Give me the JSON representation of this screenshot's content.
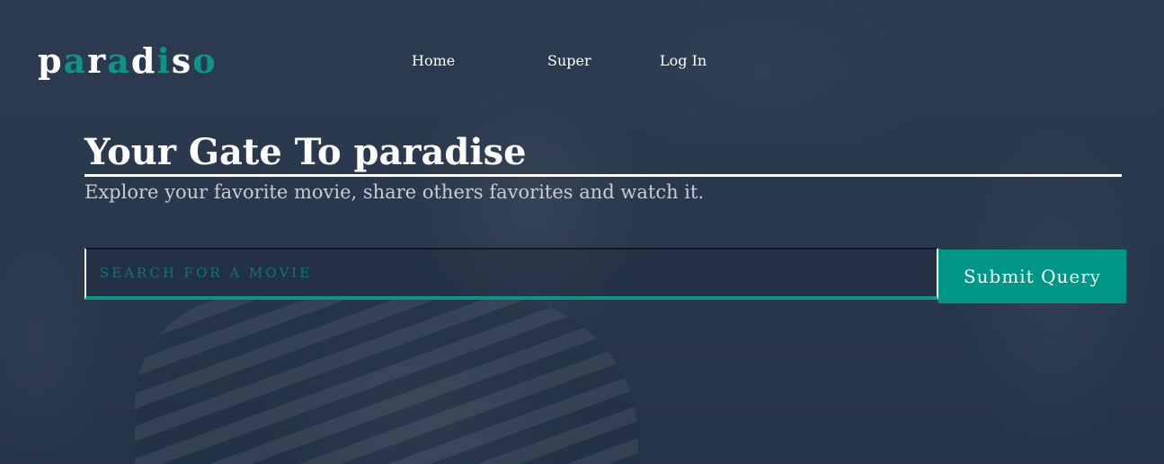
{
  "header": {
    "logo_letters": [
      "p",
      "a",
      "r",
      "a",
      "d",
      "i",
      "s",
      "o"
    ],
    "nav": {
      "home": "Home",
      "super": "Super",
      "login": "Log In"
    }
  },
  "hero": {
    "title": "Your Gate To paradise",
    "subtitle": "Explore your favorite movie, share others favorites and watch it."
  },
  "search": {
    "placeholder": "SEARCH FOR A MOVIE",
    "value": "",
    "submit_label": "Submit Query"
  },
  "colors": {
    "accent": "#009688",
    "logo_accent": "#0d9488",
    "text": "#ffffff"
  }
}
